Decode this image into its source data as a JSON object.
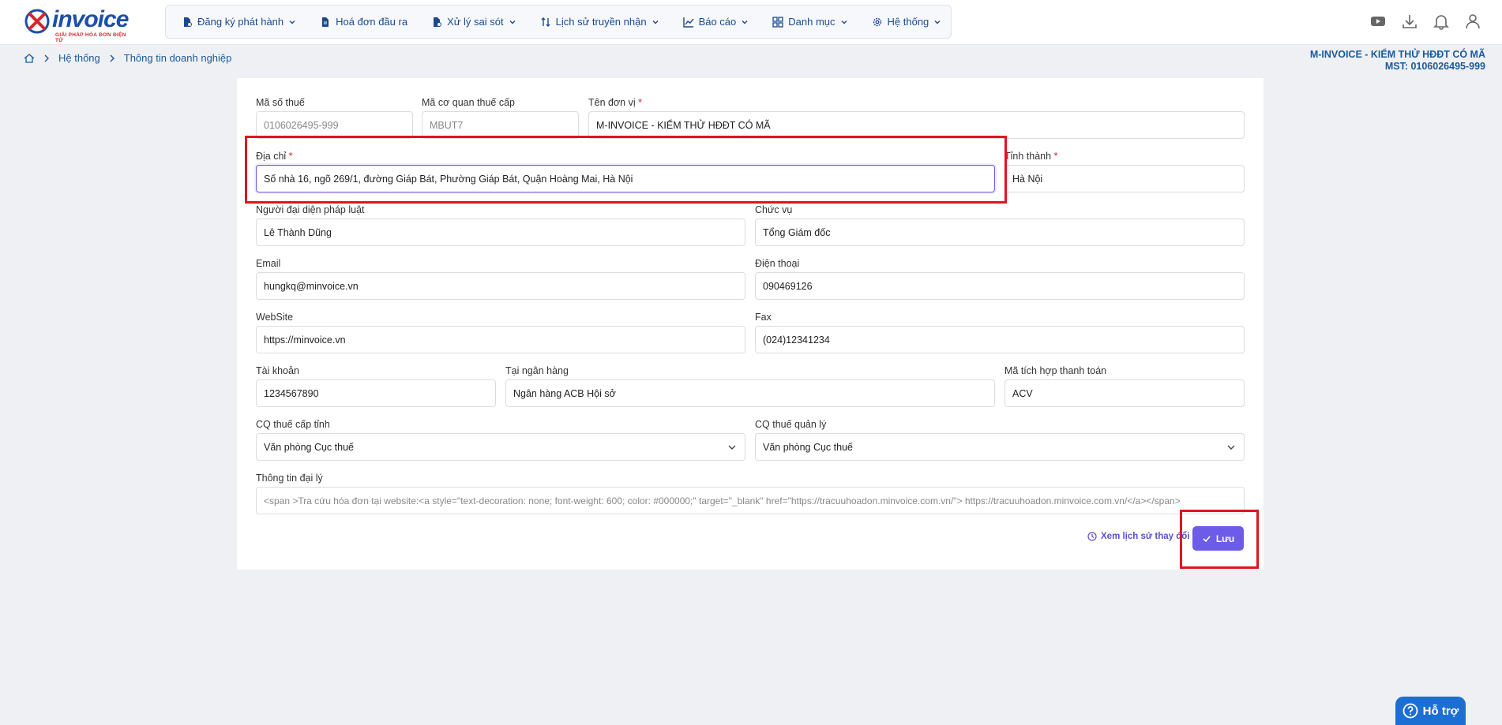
{
  "brand": {
    "name": "invoice",
    "tagline": "GIẢI PHÁP HÓA ĐƠN ĐIỆN TỬ",
    "color": "#1c4fa8",
    "accent": "#d8242c"
  },
  "nav": {
    "items": [
      {
        "label": "Đăng ký phát hành",
        "icon": "file-register-icon",
        "dropdown": true
      },
      {
        "label": "Hoá đơn đầu ra",
        "icon": "invoice-file-icon",
        "dropdown": false
      },
      {
        "label": "Xử lý sai sót",
        "icon": "file-error-icon",
        "dropdown": true
      },
      {
        "label": "Lịch sử truyền nhận",
        "icon": "transfer-arrows-icon",
        "dropdown": true
      },
      {
        "label": "Báo cáo",
        "icon": "chart-line-icon",
        "dropdown": true
      },
      {
        "label": "Danh mục",
        "icon": "grid-icon",
        "dropdown": true
      },
      {
        "label": "Hệ thống",
        "icon": "gear-icon",
        "dropdown": true
      }
    ]
  },
  "header_icons": [
    "youtube-icon",
    "download-icon",
    "bell-icon",
    "user-icon"
  ],
  "breadcrumb": {
    "home": "home-icon",
    "level1": "Hệ thống",
    "level2": "Thông tin doanh nghiệp"
  },
  "company": {
    "name": "M-INVOICE - KIỂM THỬ HĐĐT CÓ MÃ",
    "tax": "MST: 0106026495-999"
  },
  "form": {
    "tax_code": {
      "label": "Mã số thuế",
      "value": "0106026495-999"
    },
    "tax_agency_code": {
      "label": "Mã cơ quan thuế cấp",
      "value": "MBUT7"
    },
    "unit_name": {
      "label": "Tên đơn vị",
      "value": "M-INVOICE - KIỂM THỬ HĐĐT CÓ MÃ"
    },
    "address": {
      "label": "Địa chỉ",
      "value": "Số nhà 16, ngõ 269/1, đường Giáp Bát, Phường Giáp Bát, Quận Hoàng Mai, Hà Nội"
    },
    "province": {
      "label": "Tỉnh thành",
      "value": "Hà Nội"
    },
    "legal_rep": {
      "label": "Người đại diện pháp luật",
      "value": "Lê Thành Dũng"
    },
    "position": {
      "label": "Chức vụ",
      "value": "Tổng Giám đốc"
    },
    "email": {
      "label": "Email",
      "value": "hungkq@minvoice.vn"
    },
    "phone": {
      "label": "Điện thoại",
      "value": "090469126"
    },
    "website": {
      "label": "WebSite",
      "value": "https://minvoice.vn"
    },
    "fax": {
      "label": "Fax",
      "value": "(024)12341234"
    },
    "account": {
      "label": "Tài khoản",
      "value": "1234567890"
    },
    "bank": {
      "label": "Tại ngân hàng",
      "value": "Ngân hàng ACB Hội sở"
    },
    "payment_code": {
      "label": "Mã tích hợp thanh toán",
      "value": "ACV"
    },
    "prov_tax_office": {
      "label": "CQ thuế cấp tỉnh",
      "value": "Văn phòng Cục thuế"
    },
    "mgmt_tax_office": {
      "label": "CQ thuế quản lý",
      "value": "Văn phòng Cục thuế"
    },
    "agent_info": {
      "label": "Thông tin đại lý",
      "value": "<span >Tra cứu hóa đơn tại website:<a style=\"text-decoration: none; font-weight: 600; color: #000000;\" target=\"_blank\" href=\"https://tracuuhoadon.minvoice.com.vn/\"> https://tracuuhoadon.minvoice.com.vn/</a></span>"
    }
  },
  "actions": {
    "history_label": "Xem lịch sử thay đổi",
    "save_label": "Lưu"
  },
  "help": {
    "label": "Hỗ trợ"
  },
  "colors": {
    "primary": "#6c5ce7",
    "link": "#1a5a9c",
    "annotation": "#e0141e"
  }
}
